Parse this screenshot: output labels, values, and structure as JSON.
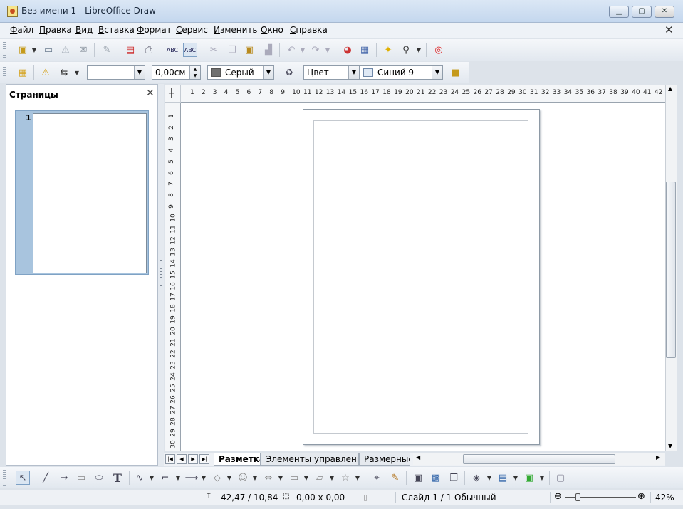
{
  "window": {
    "title": "Без имени 1 - LibreOffice Draw",
    "min": "▁",
    "max": "▢",
    "close": "✕"
  },
  "menu": [
    "Файл",
    "Правка",
    "Вид",
    "Вставка",
    "Формат",
    "Сервис",
    "Изменить",
    "Окно",
    "Справка"
  ],
  "menu_close": "✕",
  "standard_toolbar": {
    "icons": [
      "new-icon",
      "open-icon",
      "save-icon",
      "email-icon",
      "edit-file-icon",
      "export-pdf-icon",
      "print-icon",
      "spellcheck-icon",
      "autospellcheck-icon",
      "cut-icon",
      "copy-icon",
      "paste-icon",
      "clone-formatting-icon",
      "undo-icon",
      "redo-icon",
      "chart-icon",
      "display-grid-icon",
      "navigator-icon",
      "zoom-icon",
      "help-icon"
    ]
  },
  "line_toolbar": {
    "line_width": "0,00см",
    "area_color": "Серый",
    "area_style": "Цвет",
    "fill_color": "Синий 9"
  },
  "colors": {
    "area_swatch": "#707070",
    "fill_swatch": "#dfe9f5"
  },
  "sidebar": {
    "title": "Страницы",
    "page_number": "1"
  },
  "ruler": {
    "h": [
      "1",
      "2",
      "3",
      "4",
      "5",
      "6",
      "7",
      "8",
      "9",
      "10",
      "11",
      "12",
      "13",
      "14",
      "15",
      "16",
      "17",
      "18",
      "19",
      "20",
      "21",
      "22",
      "23",
      "24",
      "25",
      "26",
      "27",
      "28",
      "29",
      "30",
      "31",
      "32",
      "33",
      "34",
      "35",
      "36",
      "37",
      "38",
      "39",
      "40",
      "41",
      "42"
    ],
    "v": [
      "1",
      "2",
      "3",
      "4",
      "5",
      "6",
      "7",
      "8",
      "9",
      "10",
      "11",
      "12",
      "13",
      "14",
      "15",
      "16",
      "17",
      "18",
      "19",
      "20",
      "21",
      "22",
      "23",
      "24",
      "25",
      "26",
      "27",
      "28",
      "29",
      "30"
    ]
  },
  "tabs": [
    "Разметка",
    "Элементы управления",
    "Размерные"
  ],
  "status": {
    "position": "42,47 / 10,84",
    "size": "0,00 x 0,00",
    "slide": "Слайд 1 / 1",
    "layout": "Обычный",
    "zoom": "42%"
  }
}
